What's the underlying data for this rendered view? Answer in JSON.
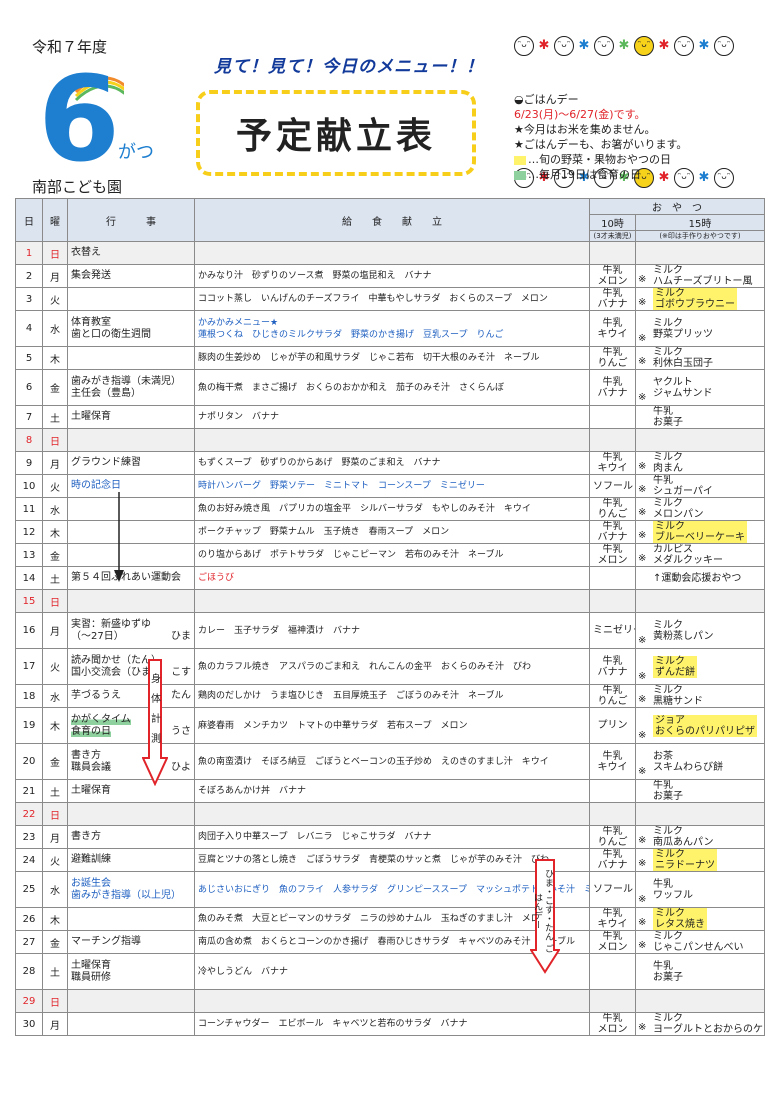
{
  "header": {
    "year": "令和７年度",
    "month_num": "6",
    "month_suffix": "がつ",
    "school": "南部こども園",
    "catch": "見て！見て！今日のメニュー！！",
    "title": "予定献立表"
  },
  "notes": {
    "n1": "ごはんデー",
    "n2": "6/23(月)～6/27(金)です。",
    "n3": "★今月はお米を集めません。",
    "n4": "★ごはんデーも、お箸がいります。",
    "n5": "…旬の野菜・果物おやつの日",
    "n6": "…毎月19日は食育の日",
    "color_yellow": "#fff36b",
    "color_green": "#8fd19e"
  },
  "columns": {
    "day": "日",
    "weekday": "曜",
    "events": "行　　　事",
    "menu": "給　　食　　献　　立",
    "snack": "お　や　つ",
    "s10": "10時",
    "s10_note": "(3才未満児)",
    "s15": "15時",
    "s15_note": "(※印は手作りおやつです)"
  },
  "rows": [
    {
      "d": "1",
      "w": "日",
      "ev": "衣替え",
      "menu": "",
      "s10": "",
      "s15": "",
      "sun": true
    },
    {
      "d": "2",
      "w": "月",
      "ev": "集会発送",
      "menu": "かみなり汁　砂ずりのソース煮　野菜の塩昆和え　バナナ",
      "s10": "牛乳\nメロン",
      "mk": "※",
      "s15": "ミルク\nハムチーズブリトー風"
    },
    {
      "d": "3",
      "w": "火",
      "ev": "",
      "menu": "ココット蒸し　いんげんのチーズフライ　中華もやしサラダ　おくらのスープ　メロン",
      "s10": "牛乳\nバナナ",
      "mk": "※",
      "s15": "ミルク\nゴボウブラウニー",
      "hl": true
    },
    {
      "d": "4",
      "w": "水",
      "ev": "体育教室\n歯と口の衛生週間",
      "menu": "かみかみメニュー★\n蓮根つくね　ひじきのミルクサラダ　野菜のかき揚げ　豆乳スープ　りんご",
      "menu_style": "blue",
      "s10": "牛乳\nキウイ",
      "mk": "※",
      "s15": "ミルク\n野菜プリッツ"
    },
    {
      "d": "5",
      "w": "木",
      "ev": "",
      "menu": "豚肉の生姜炒め　じゃが芋の和風サラダ　じゃこ若布　切干大根のみそ汁　ネーブル",
      "s10": "牛乳\nりんご",
      "mk": "※",
      "s15": "ミルク\n利休白玉団子"
    },
    {
      "d": "6",
      "w": "金",
      "ev": "歯みがき指導（未満児）\n主任会（豊島）",
      "menu": "魚の梅干煮　まさご揚げ　おくらのおかか和え　茄子のみそ汁　さくらんぼ",
      "s10": "牛乳\nバナナ",
      "mk": "※",
      "s15": "ヤクルト\nジャムサンド"
    },
    {
      "d": "7",
      "w": "土",
      "ev": "土曜保育",
      "menu": "ナポリタン　バナナ",
      "s10": "",
      "s15": "牛乳\nお菓子"
    },
    {
      "d": "8",
      "w": "日",
      "ev": "",
      "menu": "",
      "s10": "",
      "s15": "",
      "sun": true
    },
    {
      "d": "9",
      "w": "月",
      "ev": "グラウンド練習",
      "menu": "もずくスープ　砂ずりのからあげ　野菜のごま和え　バナナ",
      "s10": "牛乳\nキウイ",
      "mk": "※",
      "s15": "ミルク\n肉まん"
    },
    {
      "d": "10",
      "w": "火",
      "ev": "時の記念日",
      "ev_blue": true,
      "menu": "時計ハンバーグ　野菜ソテー　ミニトマト　コーンスープ　ミニゼリー",
      "menu_style": "blue",
      "s10": "ソフール",
      "mk": "※",
      "s15": "牛乳\nシュガーパイ"
    },
    {
      "d": "11",
      "w": "水",
      "ev": "",
      "menu": "魚のお好み焼き風　パプリカの塩金平　シルバーサラダ　もやしのみそ汁　キウイ",
      "s10": "牛乳\nりんご",
      "mk": "※",
      "s15": "ミルク\nメロンパン"
    },
    {
      "d": "12",
      "w": "木",
      "ev": "",
      "menu": "ポークチャップ　野菜ナムル　玉子焼き　春雨スープ　メロン",
      "s10": "牛乳\nバナナ",
      "mk": "※",
      "s15": "ミルク\nブルーベリーケーキ",
      "hl": true
    },
    {
      "d": "13",
      "w": "金",
      "ev": "",
      "menu": "のり塩からあげ　ポテトサラダ　じゃこピーマン　若布のみそ汁　ネーブル",
      "s10": "牛乳\nメロン",
      "mk": "※",
      "s15": "カルピス\nメダルクッキー"
    },
    {
      "d": "14",
      "w": "土",
      "ev": "第５４回ふれあい運動会",
      "menu": "ごほうび",
      "menu_style": "red",
      "s10": "",
      "s15": "↑運動会応援おやつ"
    },
    {
      "d": "15",
      "w": "日",
      "ev": "",
      "menu": "",
      "s10": "",
      "s15": "",
      "sun": true
    },
    {
      "d": "16",
      "w": "月",
      "ev": "実習：新盛ゆずゆ\n（～27日）",
      "side": "ひま",
      "menu": "カレー　玉子サラダ　福神漬け　バナナ",
      "s10": "ミニゼリー",
      "mk": "※",
      "s15": "ミルク\n黄粉蒸しパン"
    },
    {
      "d": "17",
      "w": "火",
      "ev": "読み聞かせ（たん）\n国小交流会（ひま）",
      "side": "こす",
      "menu": "魚のカラフル焼き　アスパラのごま和え　れんこんの金平　おくらのみそ汁　びわ",
      "s10": "牛乳\nバナナ",
      "mk": "※",
      "s15": "ミルク\nずんだ餅",
      "hl": true
    },
    {
      "d": "18",
      "w": "水",
      "ev": "芋づるうえ",
      "side": "たん",
      "menu": "鶏肉のだしかけ　うま塩ひじき　五目厚焼玉子　ごぼうのみそ汁　ネーブル",
      "s10": "牛乳\nりんご",
      "mk": "※",
      "s15": "ミルク\n黒糖サンド"
    },
    {
      "d": "19",
      "w": "木",
      "ev": "かがくタイム\n食育の日",
      "ev_green": true,
      "side": "うさ",
      "menu": "麻婆春雨　メンチカツ　トマトの中華サラダ　若布スープ　メロン",
      "s10": "プリン",
      "mk": "※",
      "s15": "ジョア\nおくらのパリパリピザ",
      "hl": true
    },
    {
      "d": "20",
      "w": "金",
      "ev": "書き方\n職員会議",
      "side": "ひよ",
      "menu": "魚の南蛮漬け　そぼろ納豆　ごぼうとベーコンの玉子炒め　えのきのすまし汁　キウイ",
      "s10": "牛乳\nキウイ",
      "mk": "※",
      "s15": "お茶\nスキムわらび餅"
    },
    {
      "d": "21",
      "w": "土",
      "ev": "土曜保育",
      "menu": "そぼろあんかけ丼　バナナ",
      "s10": "",
      "s15": "牛乳\nお菓子"
    },
    {
      "d": "22",
      "w": "日",
      "ev": "",
      "menu": "",
      "s10": "",
      "s15": "",
      "sun": true
    },
    {
      "d": "23",
      "w": "月",
      "ev": "書き方",
      "menu": "肉団子入り中華スープ　レバニラ　じゃこサラダ　バナナ",
      "s10": "牛乳\nりんご",
      "mk": "※",
      "s15": "ミルク\n南瓜あんパン"
    },
    {
      "d": "24",
      "w": "火",
      "ev": "避難訓練",
      "menu": "豆腐とツナの落とし焼き　ごぼうサラダ　青梗菜のサッと煮　じゃが芋のみそ汁　びわ",
      "s10": "牛乳\nバナナ",
      "mk": "※",
      "s15": "ミルク\nニラドーナツ",
      "hl": true
    },
    {
      "d": "25",
      "w": "水",
      "ev": "お誕生会\n歯みがき指導（以上児）",
      "ev_blue": true,
      "menu": "あじさいおにぎり　魚のフライ　人参サラダ　グリンピーススープ　マッシュポテト　みそ汁　ミニゼリー",
      "menu_style": "blue",
      "s10": "ソフール",
      "mk": "※",
      "s15": "牛乳\nワッフル"
    },
    {
      "d": "26",
      "w": "木",
      "ev": "",
      "menu": "魚のみそ煮　大豆とピーマンのサラダ　ニラの炒めナムル　玉ねぎのすまし汁　メロン",
      "s10": "牛乳\nキウイ",
      "mk": "※",
      "s15": "ミルク\nレタス焼き",
      "hl": true
    },
    {
      "d": "27",
      "w": "金",
      "ev": "マーチング指導",
      "menu": "南瓜の含め煮　おくらとコーンのかき揚げ　春雨ひじきサラダ　キャベツのみそ汁　ネーブル",
      "s10": "牛乳\nメロン",
      "mk": "※",
      "s15": "ミルク\nじゃこパンせんべい"
    },
    {
      "d": "28",
      "w": "土",
      "ev": "土曜保育\n職員研修",
      "menu": "冷やしうどん　バナナ",
      "s10": "",
      "s15": "牛乳\nお菓子"
    },
    {
      "d": "29",
      "w": "日",
      "ev": "",
      "menu": "",
      "s10": "",
      "s15": "",
      "sun": true
    },
    {
      "d": "30",
      "w": "月",
      "ev": "",
      "menu": "コーンチャウダー　エビボール　キャベツと若布のサラダ　バナナ",
      "s10": "牛乳\nメロン",
      "mk": "※",
      "s15": "ミルク\nヨーグルトとおからのケーキ"
    }
  ],
  "side_label": "身体計測",
  "gohan_label": "ひま・こす・たん ごはんデー"
}
